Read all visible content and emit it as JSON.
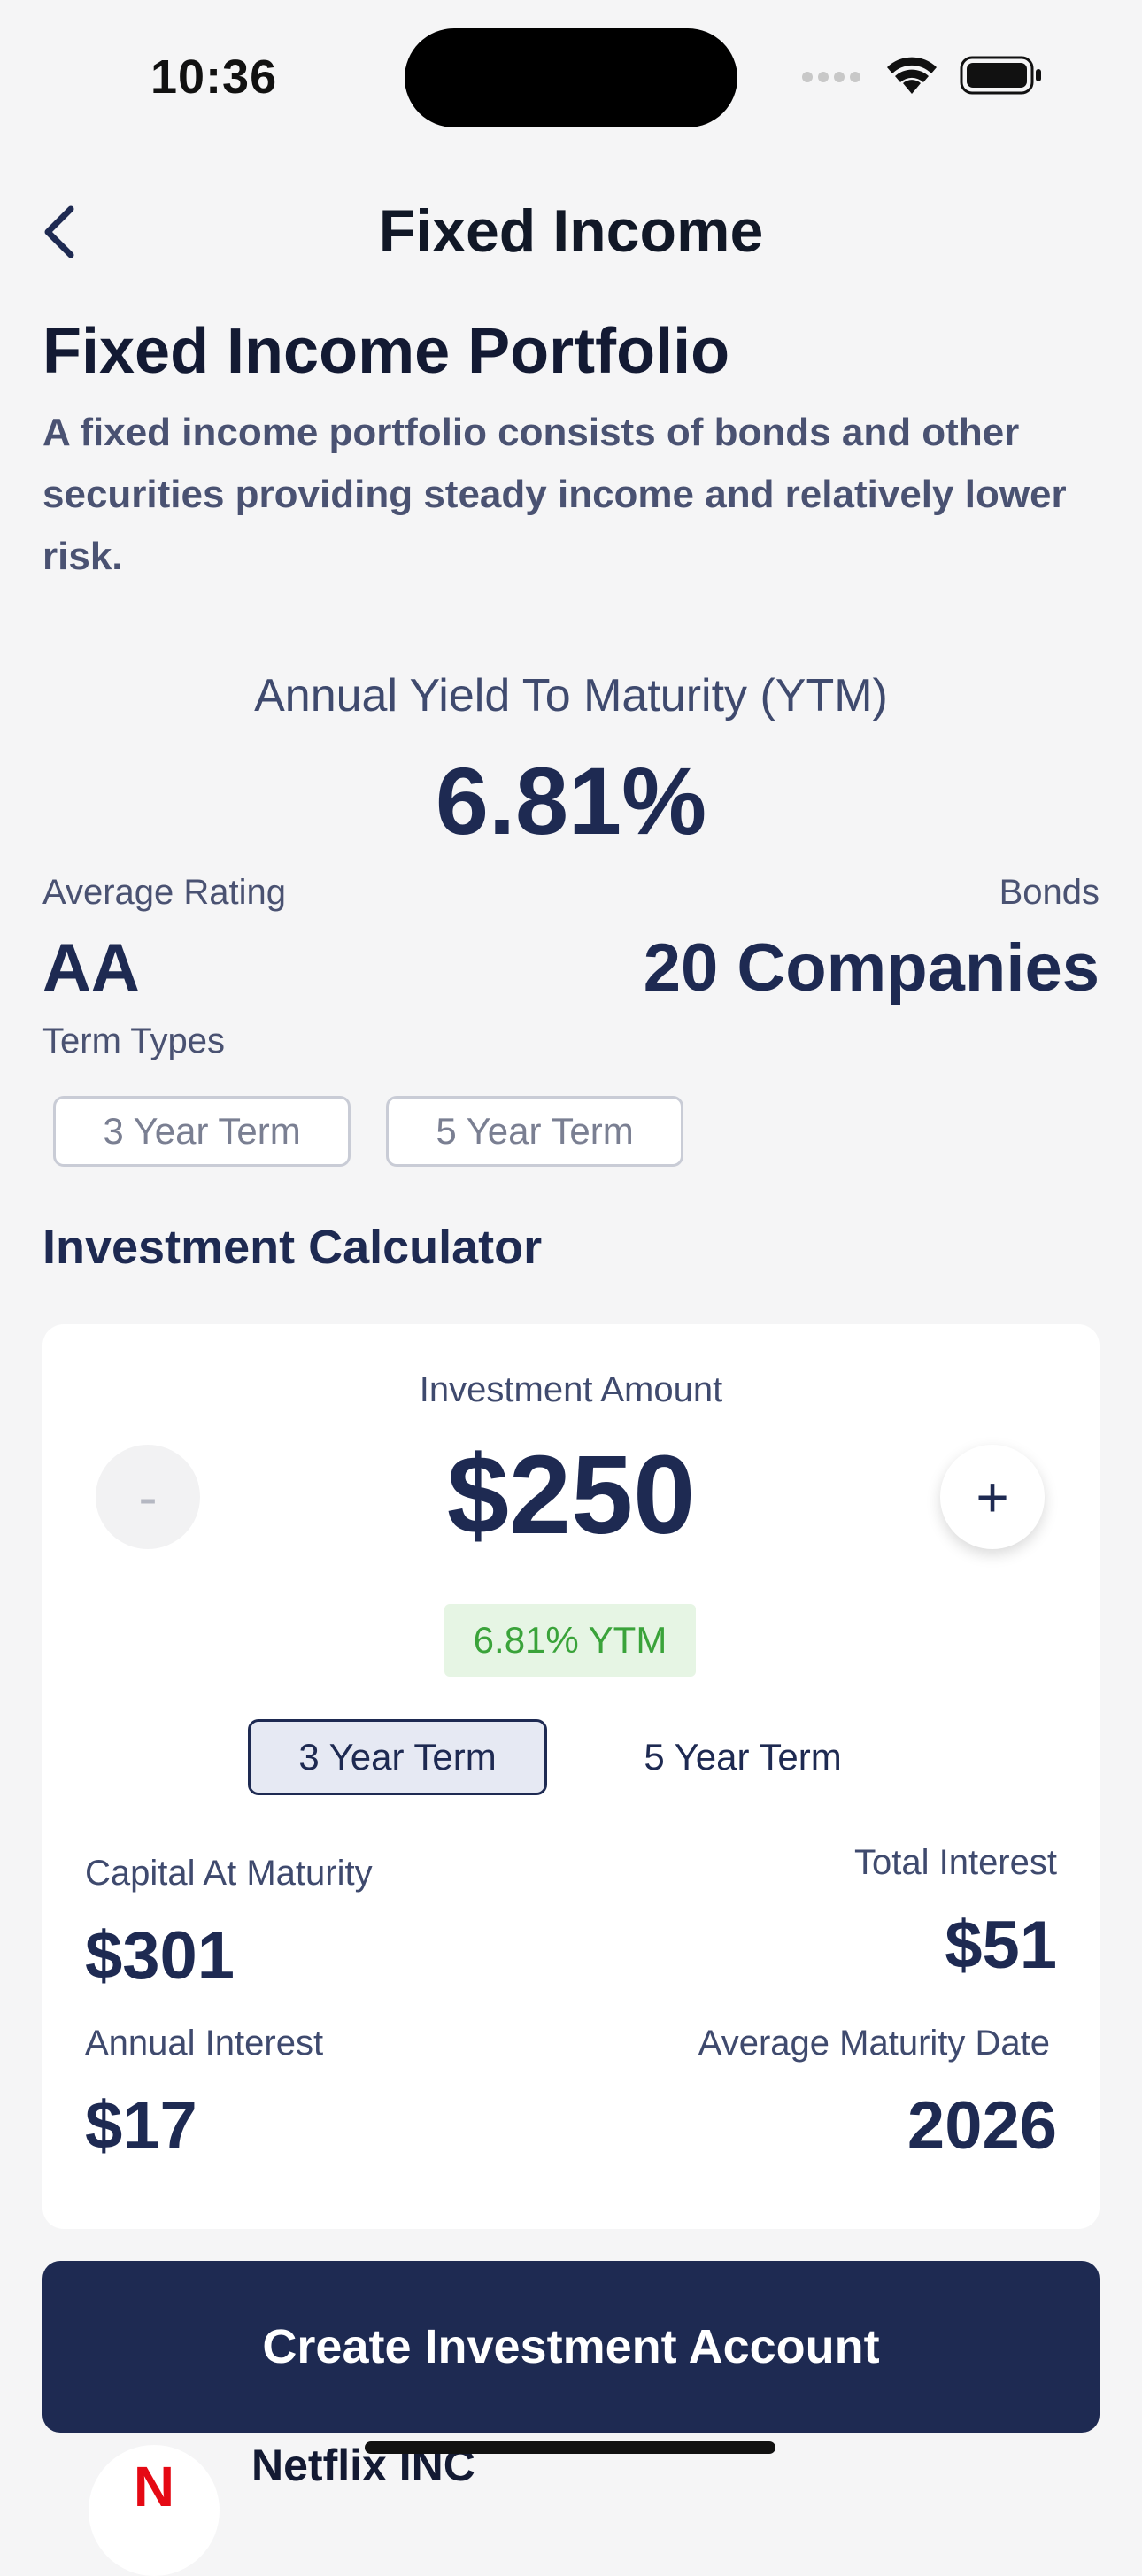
{
  "status": {
    "time": "10:36"
  },
  "nav": {
    "title": "Fixed Income"
  },
  "portfolio": {
    "title": "Fixed Income Portfolio",
    "description": "A fixed income portfolio consists of bonds and other securities providing steady income and relatively lower risk.",
    "ytm_label": "Annual Yield To Maturity (YTM)",
    "ytm_value": "6.81%",
    "rating_label": "Average Rating",
    "rating_value": "AA",
    "bonds_label": "Bonds",
    "bonds_value": "20 Companies",
    "term_types_label": "Term Types",
    "term_types": [
      "3 Year Term",
      "5 Year Term"
    ]
  },
  "calculator": {
    "title": "Investment Calculator",
    "amount_label": "Investment Amount",
    "amount_value": "$250",
    "minus_label": "-",
    "plus_label": "+",
    "ytm_badge": "6.81% YTM",
    "terms": [
      "3 Year Term",
      "5 Year Term"
    ],
    "selected_term": "3 Year Term",
    "capital_label": "Capital At Maturity",
    "capital_value": "$301",
    "total_interest_label": "Total Interest",
    "total_interest_value": "$51",
    "annual_interest_label": "Annual Interest",
    "annual_interest_value": "$17",
    "maturity_label": "Average Maturity Date",
    "maturity_value": "2026"
  },
  "cta": {
    "label": "Create Investment Account"
  },
  "list_peek": {
    "company_name": "Netflix INC",
    "logo_letter": "N"
  },
  "colors": {
    "brand": "#1e2a52",
    "ytm_green": "#3aa33a",
    "ytm_green_bg": "#e6f5e4",
    "netflix_red": "#e50914"
  }
}
